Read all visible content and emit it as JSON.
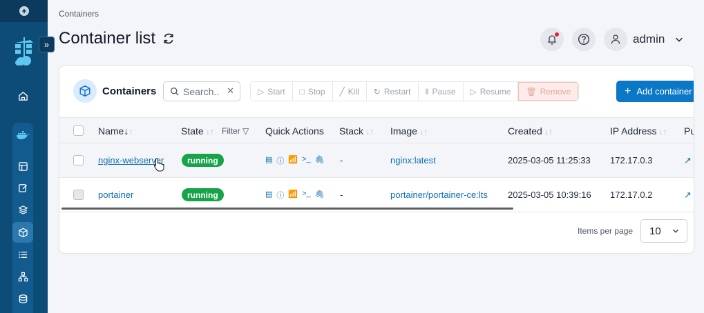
{
  "breadcrumb": "Containers",
  "page_title": "Container list",
  "header": {
    "user": "admin"
  },
  "card": {
    "title": "Containers"
  },
  "search": {
    "placeholder": "Search..",
    "value": ""
  },
  "actions": {
    "start": "Start",
    "stop": "Stop",
    "kill": "Kill",
    "restart": "Restart",
    "pause": "Pause",
    "resume": "Resume",
    "remove": "Remove",
    "add": "Add container"
  },
  "columns": {
    "name": "Name",
    "state": "State",
    "filter": "Filter",
    "quick_actions": "Quick Actions",
    "stack": "Stack",
    "image": "Image",
    "created": "Created",
    "ip": "IP Address",
    "ports": "Pu"
  },
  "rows": [
    {
      "name": "nginx-webserver",
      "state": "running",
      "stack": "-",
      "image": "nginx:latest",
      "created": "2025-03-05 11:25:33",
      "ip": "172.17.0.3"
    },
    {
      "name": "portainer",
      "state": "running",
      "stack": "-",
      "image": "portainer/portainer-ce:lts",
      "created": "2025-03-05 10:39:16",
      "ip": "172.17.0.2"
    }
  ],
  "pagination": {
    "label": "Items per page",
    "value": "10"
  },
  "colors": {
    "sidebar": "#0e4c78",
    "accent": "#0b78c7",
    "running": "#16a34a",
    "link": "#0e6fb0"
  }
}
